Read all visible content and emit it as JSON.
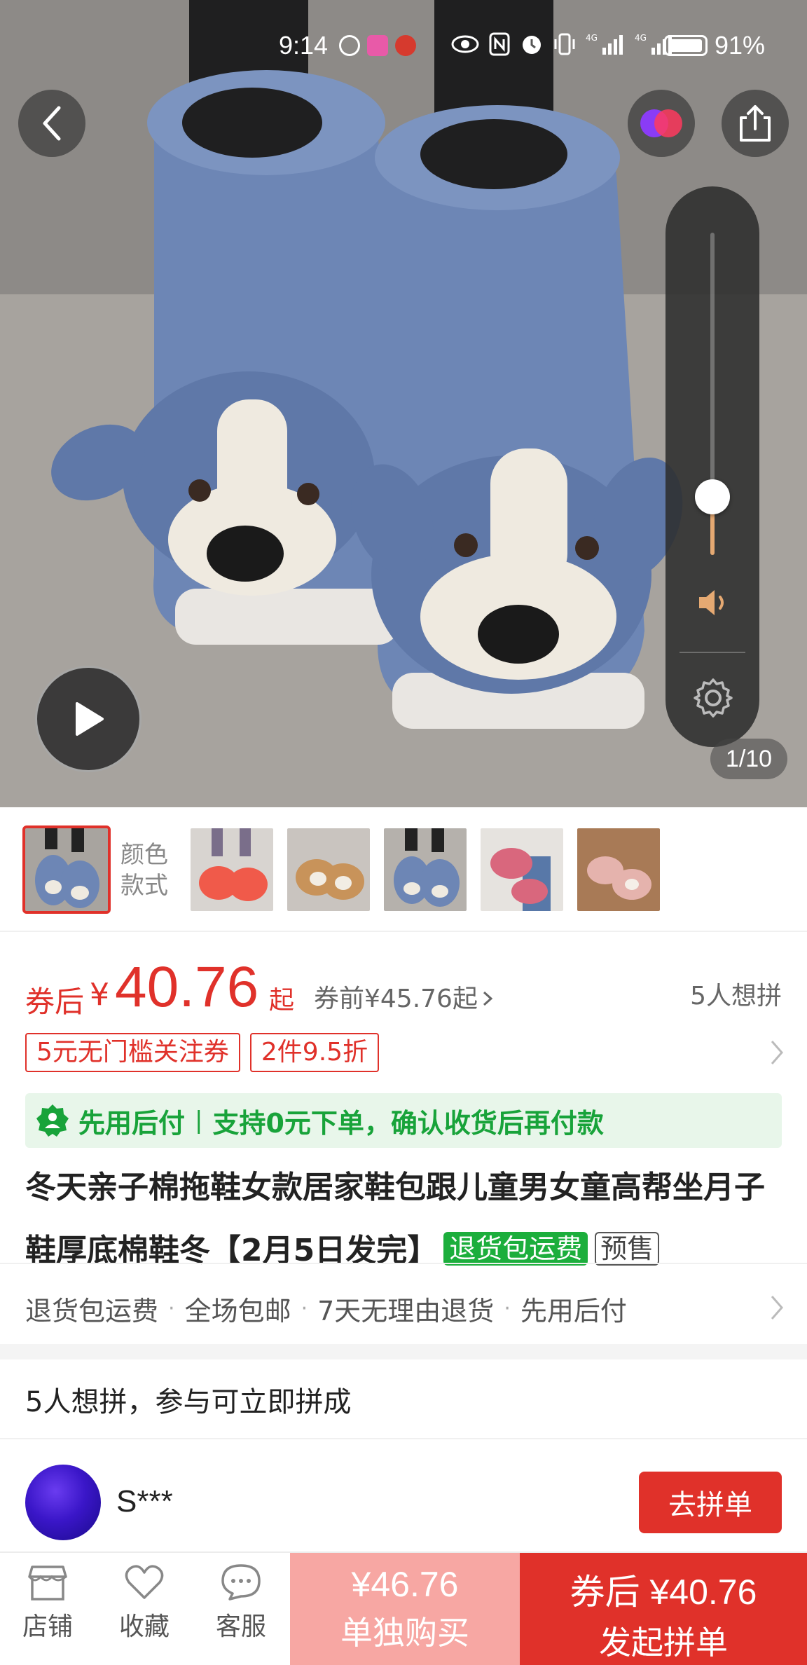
{
  "status_bar": {
    "time": "9:14",
    "battery": "91%"
  },
  "media": {
    "counter": "1/10"
  },
  "thumbnails": {
    "color_label": "颜色款式"
  },
  "price": {
    "prefix": "券后",
    "currency": "¥",
    "amount": "40.76",
    "suffix": "起",
    "pre_coupon": "券前¥45.76起",
    "want_count": "5人想拼"
  },
  "coupons": [
    "5元无门槛关注券",
    "2件9.5折"
  ],
  "pay_after": {
    "title": "先用后付",
    "separator": "|",
    "desc": "支持0元下单，确认收货后再付款"
  },
  "product": {
    "title": "冬天亲子棉拖鞋女款居家鞋包跟儿童男女童高帮坐月子鞋厚底棉鞋冬【2月5日发完】",
    "tag_green": "退货包运费",
    "tag_outline": "预售"
  },
  "services": [
    "退货包运费",
    "全场包邮",
    "7天无理由退货",
    "先用后付"
  ],
  "group": {
    "heading": "5人想拼，参与可立即拼成",
    "user_name": "S***",
    "join_label": "去拼单"
  },
  "bottom_nav": {
    "store": "店铺",
    "favorite": "收藏",
    "service": "客服"
  },
  "buy": {
    "solo_price": "¥46.76",
    "solo_label": "单独购买",
    "group_price": "券后 ¥40.76",
    "group_label": "发起拼单"
  },
  "volume": {
    "level": 0.18
  },
  "colors": {
    "accent_red": "#e0312a",
    "pay_green": "#18a33a",
    "solo_pink": "#f7a7a3"
  }
}
